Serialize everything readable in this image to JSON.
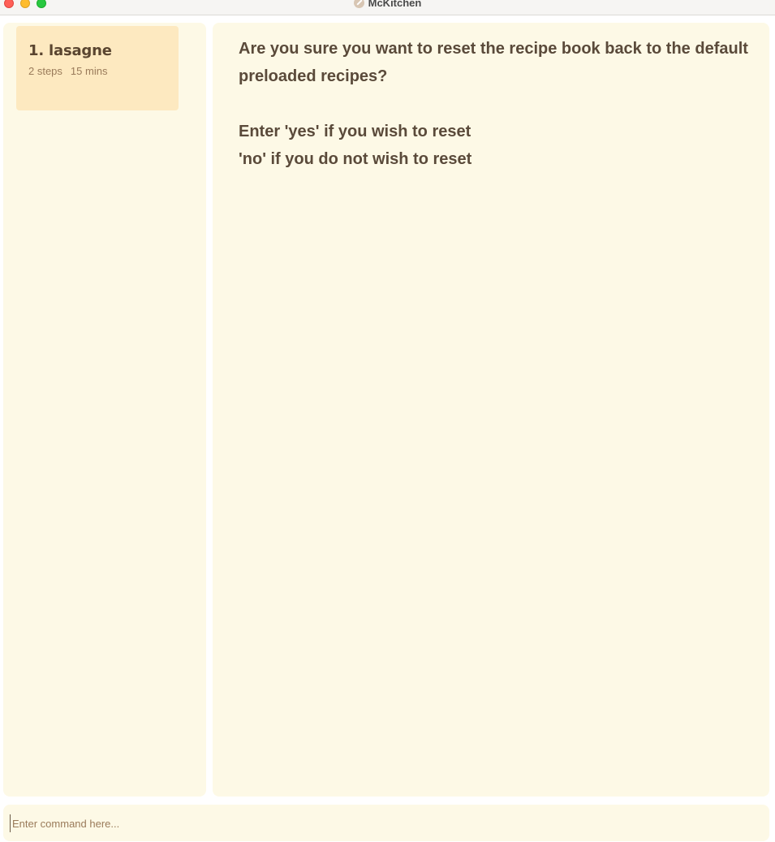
{
  "window": {
    "title": "McKitchen"
  },
  "sidebar": {
    "recipes": [
      {
        "title": "1. lasagne",
        "steps": "2 steps",
        "duration": "15 mins"
      }
    ]
  },
  "main": {
    "lines": [
      "Are you sure you want to reset the recipe book back to the default preloaded recipes?",
      "Enter 'yes' if you wish to reset",
      "'no' if you do not wish to reset"
    ]
  },
  "command": {
    "value": "",
    "placeholder": "Enter command here..."
  },
  "colors": {
    "panel_bg": "#fdf9e6",
    "card_bg": "#fde9c0",
    "text_primary": "#5a4a3a",
    "text_secondary": "#9a7b5a"
  }
}
